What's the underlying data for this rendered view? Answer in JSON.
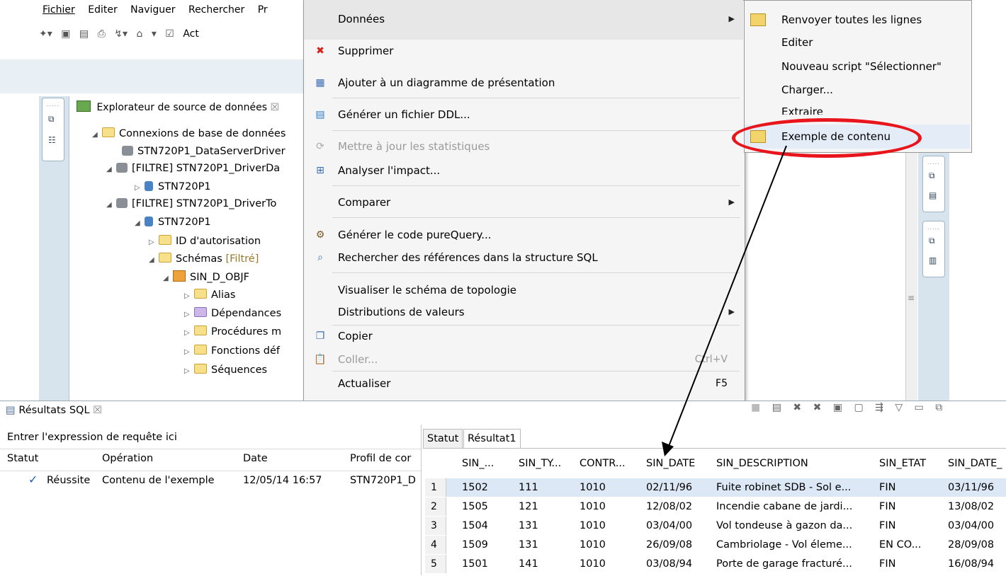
{
  "menubar": {
    "items": [
      "Fichier",
      "Editer",
      "Naviguer",
      "Rechercher",
      "Pr"
    ]
  },
  "toolbar": {
    "act_label": "Act"
  },
  "explorer": {
    "title": "Explorateur de source de données",
    "tree": [
      {
        "label": "Connexions de base de données"
      },
      {
        "label": "STN720P1_DataServerDriver"
      },
      {
        "label": "[FILTRE] STN720P1_DriverDa"
      },
      {
        "label": "STN720P1"
      },
      {
        "label": "[FILTRE] STN720P1_DriverTo"
      },
      {
        "label": "STN720P1"
      },
      {
        "label": "ID d'autorisation"
      },
      {
        "label": "Schémas",
        "suffix": "[Filtré]"
      },
      {
        "label": "SIN_D_OBJF"
      },
      {
        "label": "Alias"
      },
      {
        "label": "Dépendances"
      },
      {
        "label": "Procédures m"
      },
      {
        "label": "Fonctions déf"
      },
      {
        "label": "Séquences"
      }
    ]
  },
  "context_menu": {
    "items": [
      {
        "label": "Données"
      },
      {
        "label": "Supprimer"
      },
      {
        "label": "Ajouter à un diagramme de présentation"
      },
      {
        "label": "Générer un fichier DDL..."
      },
      {
        "label": "Mettre à jour les statistiques"
      },
      {
        "label": "Analyser l'impact..."
      },
      {
        "label": "Comparer"
      },
      {
        "label": "Générer le code pureQuery..."
      },
      {
        "label": "Rechercher des références dans la structure SQL"
      },
      {
        "label": "Visualiser le schéma de topologie"
      },
      {
        "label": "Distributions de valeurs"
      },
      {
        "label": "Copier"
      },
      {
        "label": "Coller...",
        "shortcut": "Ctrl+V"
      },
      {
        "label": "Actualiser",
        "shortcut": "F5"
      }
    ]
  },
  "submenu": {
    "items": [
      "Renvoyer toutes les lignes",
      "Editer",
      "Nouveau script \"Sélectionner\"",
      "Charger...",
      "Extraire",
      "Exemple de contenu"
    ]
  },
  "results_view": {
    "tab": "Résultats SQL",
    "query_placeholder": "Entrer l'expression de requête ici",
    "columns": [
      "Statut",
      "Opération",
      "Date",
      "Profil de cor"
    ],
    "rows": [
      {
        "status": "Réussite",
        "operation": "Contenu de l'exemple",
        "date": "12/05/14 16:57",
        "profile": "STN720P1_D"
      }
    ]
  },
  "result_tabs": [
    "Statut",
    "Résultat1"
  ],
  "result_grid": {
    "columns": [
      "SIN_...",
      "SIN_TY...",
      "CONTR...",
      "SIN_DATE",
      "SIN_DESCRIPTION",
      "SIN_ETAT",
      "SIN_DATE_"
    ],
    "rows": [
      {
        "n": "1",
        "cells": [
          "1502",
          "111",
          "1010",
          "02/11/96",
          "Fuite robinet SDB - Sol e...",
          "FIN",
          "03/11/96"
        ]
      },
      {
        "n": "2",
        "cells": [
          "1505",
          "121",
          "1010",
          "12/08/02",
          "Incendie cabane de jardi...",
          "FIN",
          "13/08/02"
        ]
      },
      {
        "n": "3",
        "cells": [
          "1504",
          "131",
          "1010",
          "03/04/00",
          "Vol tondeuse à gazon da...",
          "FIN",
          "03/04/00"
        ]
      },
      {
        "n": "4",
        "cells": [
          "1509",
          "131",
          "1010",
          "26/09/08",
          "Cambriolage - Vol éleme...",
          "EN CO...",
          "28/09/08"
        ]
      },
      {
        "n": "5",
        "cells": [
          "1501",
          "141",
          "1010",
          "03/08/94",
          "Porte de garage fracturé...",
          "FIN",
          "16/08/94"
        ]
      }
    ]
  },
  "colors": {
    "highlight_ellipse": "#e8161c",
    "selected_row": "#dde8f6",
    "panel_strip": "#d7e4ee"
  }
}
